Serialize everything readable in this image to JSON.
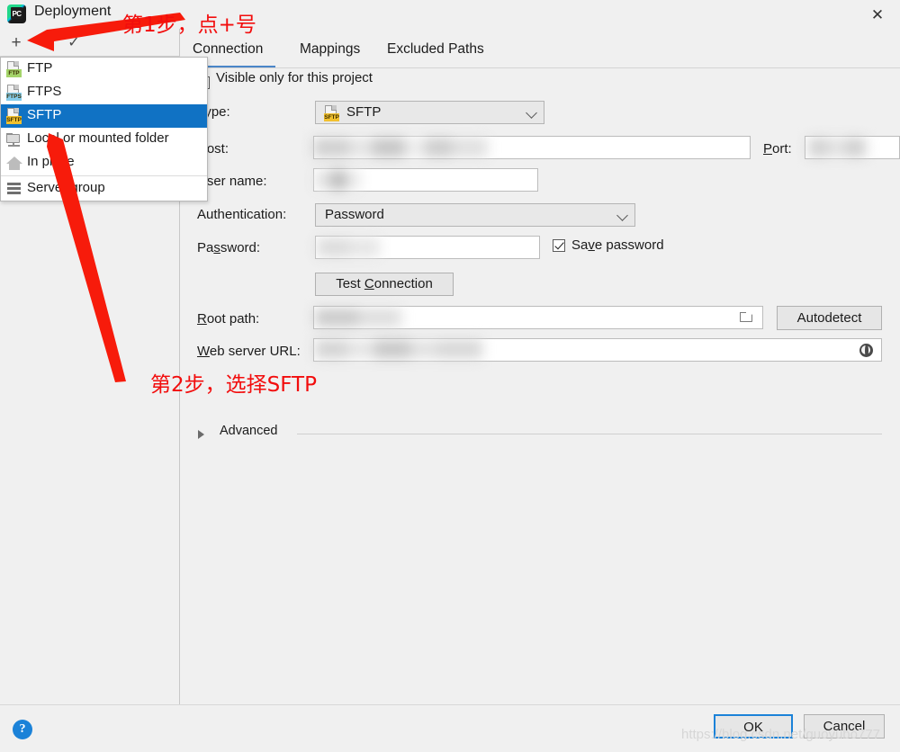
{
  "window": {
    "title": "Deployment",
    "logo_icon": "pycharm-logo",
    "logo_text": "PC",
    "close_icon": "✕"
  },
  "left_panel": {
    "toolbar": {
      "add_icon": "+",
      "remove_icon": "−",
      "apply_icon": "✓"
    }
  },
  "type_dropdown": {
    "items": [
      {
        "label": "FTP",
        "icon": "ftp-icon",
        "badge": "FTP",
        "selected": false
      },
      {
        "label": "FTPS",
        "icon": "ftps-icon",
        "badge": "FTPS",
        "selected": false
      },
      {
        "label": "SFTP",
        "icon": "sftp-icon",
        "badge": "SFTP",
        "selected": true
      },
      {
        "label": "Local or mounted folder",
        "icon": "folder-icon",
        "badge": "",
        "selected": false
      },
      {
        "label": "In place",
        "icon": "home-icon",
        "badge": "",
        "selected": false
      },
      {
        "label": "Server group",
        "icon": "server-group-icon",
        "badge": "",
        "selected": false
      }
    ]
  },
  "tabs": [
    {
      "label": "Connection",
      "active": true
    },
    {
      "label": "Mappings",
      "active": false
    },
    {
      "label": "Excluded Paths",
      "active": false
    }
  ],
  "form": {
    "visible_only_label": "Visible only for this project",
    "visible_only_checked": false,
    "type_label": "Type:",
    "type_value": "SFTP",
    "type_icon": "sftp-icon",
    "host_label": "Host:",
    "host_value": "",
    "port_label": "Port:",
    "port_value": "",
    "user_name_label": "User name:",
    "user_name_value": "",
    "authentication_label": "Authentication:",
    "authentication_value": "Password",
    "password_label": "Password:",
    "password_value": "",
    "save_password_label": "Save password",
    "save_password_checked": true,
    "test_connection_label": "Test Connection",
    "root_path_label": "Root path:",
    "root_path_value": "",
    "browse_icon": "browse-folder-icon",
    "autodetect_label": "Autodetect",
    "web_server_url_label": "Web server URL:",
    "web_server_url_value": "",
    "web_url_icon": "globe-icon",
    "advanced_label": "Advanced",
    "advanced_expanded": false,
    "advanced_icon": "chevron-right-icon"
  },
  "footer": {
    "help_icon": "?",
    "ok_label": "OK",
    "cancel_label": "Cancel"
  },
  "annotations": [
    {
      "text": "第1步，点+号",
      "color": "#f20d0d"
    },
    {
      "text": "第2步，选择SFTP",
      "color": "#f20d0d"
    }
  ],
  "watermark": "https://blog.csdn.net/guoyubo777"
}
